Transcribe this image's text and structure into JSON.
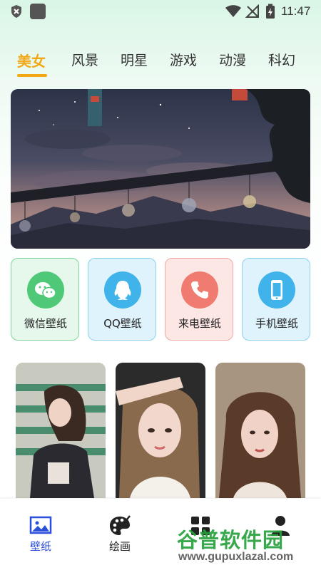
{
  "status_bar": {
    "time": "11:47",
    "icons": [
      "shield-x-icon",
      "app-square-icon",
      "wifi-icon",
      "signal-off-icon",
      "battery-charging-icon"
    ]
  },
  "tabs": [
    {
      "label": "美女",
      "active": true
    },
    {
      "label": "风景",
      "active": false
    },
    {
      "label": "明星",
      "active": false
    },
    {
      "label": "游戏",
      "active": false
    },
    {
      "label": "动漫",
      "active": false
    },
    {
      "label": "科幻",
      "active": false
    }
  ],
  "banner": {
    "image": "dusk-sky-wind-chimes"
  },
  "categories": [
    {
      "label": "微信壁纸",
      "icon": "wechat-icon",
      "bg": "#e6f8ec",
      "border": "#7fd69a",
      "circle": "#4fc978"
    },
    {
      "label": "QQ壁纸",
      "icon": "qq-penguin-icon",
      "bg": "#def3fb",
      "border": "#8cd3ef",
      "circle": "#3fb3ea"
    },
    {
      "label": "来电壁纸",
      "icon": "phone-icon",
      "bg": "#fde7e5",
      "border": "#f3a9a3",
      "circle": "#f07b70"
    },
    {
      "label": "手机壁纸",
      "icon": "mobile-phone-icon",
      "bg": "#def3fb",
      "border": "#8cd3ef",
      "circle": "#3fb3ea"
    }
  ],
  "photos": [
    "portrait-girl-stadium",
    "portrait-girl-salute",
    "portrait-girl-long-hair"
  ],
  "bottom_nav": [
    {
      "label": "壁纸",
      "icon": "image-icon",
      "active": true
    },
    {
      "label": "绘画",
      "icon": "palette-icon",
      "active": false
    },
    {
      "label": "",
      "icon": "grid-icon",
      "active": false
    },
    {
      "label": "",
      "icon": "user-icon",
      "active": false
    }
  ],
  "watermark": {
    "text": "谷普软件园",
    "url": "www.gupuxlazal.com"
  },
  "colors": {
    "accent": "#f2a814",
    "nav_active": "#2b4fd8"
  }
}
